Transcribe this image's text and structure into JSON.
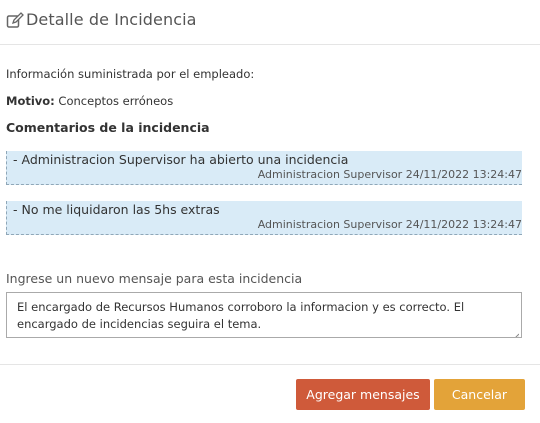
{
  "header": {
    "title": "Detalle de Incidencia",
    "icon": "edit-icon"
  },
  "info_text": "Información suministrada por el empleado:",
  "motivo": {
    "label": "Motivo:",
    "value": " Conceptos erróneos"
  },
  "comments_title": "Comentarios de la incidencia",
  "comments": [
    {
      "message": "- Administracion Supervisor ha abierto una incidencia",
      "meta": "Administracion Supervisor 24/11/2022 13:24:47"
    },
    {
      "message": "- No me liquidaron las 5hs extras",
      "meta": "Administracion Supervisor 24/11/2022 13:24:47"
    }
  ],
  "new_message": {
    "label": "Ingrese un nuevo mensaje para esta incidencia",
    "value": "El encargado de Recursos Humanos corroboro la informacion y es correcto. El encargado de incidencias seguira el tema."
  },
  "buttons": {
    "add": "Agregar mensajes",
    "cancel": "Cancelar"
  },
  "colors": {
    "add_button": "#cf5a3a",
    "cancel_button": "#e3a339",
    "comment_bg": "#d9ebf7"
  }
}
